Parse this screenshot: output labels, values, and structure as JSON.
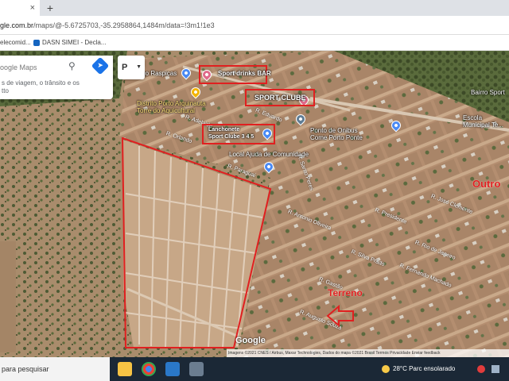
{
  "browser": {
    "tab_close": "×",
    "new_tab": "+",
    "url_host": "gle.com.br",
    "url_path": "/maps/@-5.6725703,-35.2958864,1484m/data=!3m1!1e3",
    "bookmarks": [
      {
        "label": "elecomid...",
        "color": "#c62828"
      },
      {
        "label": "DASN SIMEI - Decla...",
        "color": "#1565c0"
      }
    ]
  },
  "maps": {
    "search_placeholder": "oogle Maps",
    "search_hint": "s de viagem, o trânsito e os\ntto",
    "layer_label": "P",
    "attribution": "Imagens ©2021 CNES / Airbus, Maxar Technologies, Dados do mapa ©2021   Brasil   Termos   Privacidade   Enviar feedback",
    "google_logo": "Google",
    "annotations": {
      "sport_top": "Sport drinks BAR",
      "sport_clube": "SPORT CLUBE",
      "lanchonete": "Lanchonete\nSport Clube 3 4 5",
      "outro": "Outro",
      "terreno": "Terreno"
    },
    "places": {
      "lagoa": "elgo Raspicas",
      "distrito": "Distrito Porto Arquinauta\nTorre do Aquicultural",
      "lanchonete_pin": "Lanchonete\nSport Clube 3 4 5",
      "ponto": "Ponto de Onibus\nCome Porto Ponte",
      "local": "Local Ajuda de Comunidade",
      "bairro": "Bairro Sport",
      "escola": "Escola\nMunicipal Te..."
    },
    "streets": [
      "R. Adelaide",
      "R. Eduardo",
      "R. Paraguai",
      "R. Orlando",
      "R. Cruz",
      "R. Santo Peres",
      "R. Antonio Oliveira",
      "R. Presidente",
      "R. Rio de Janeiro",
      "R. José Clemente",
      "R. Silva Prado",
      "R. Fernando Machado",
      "R. Gastão",
      "R. Augusto Souza"
    ]
  },
  "taskbar": {
    "search_label": "para pesquisar",
    "weather": "28°C  Parc ensolarado"
  }
}
